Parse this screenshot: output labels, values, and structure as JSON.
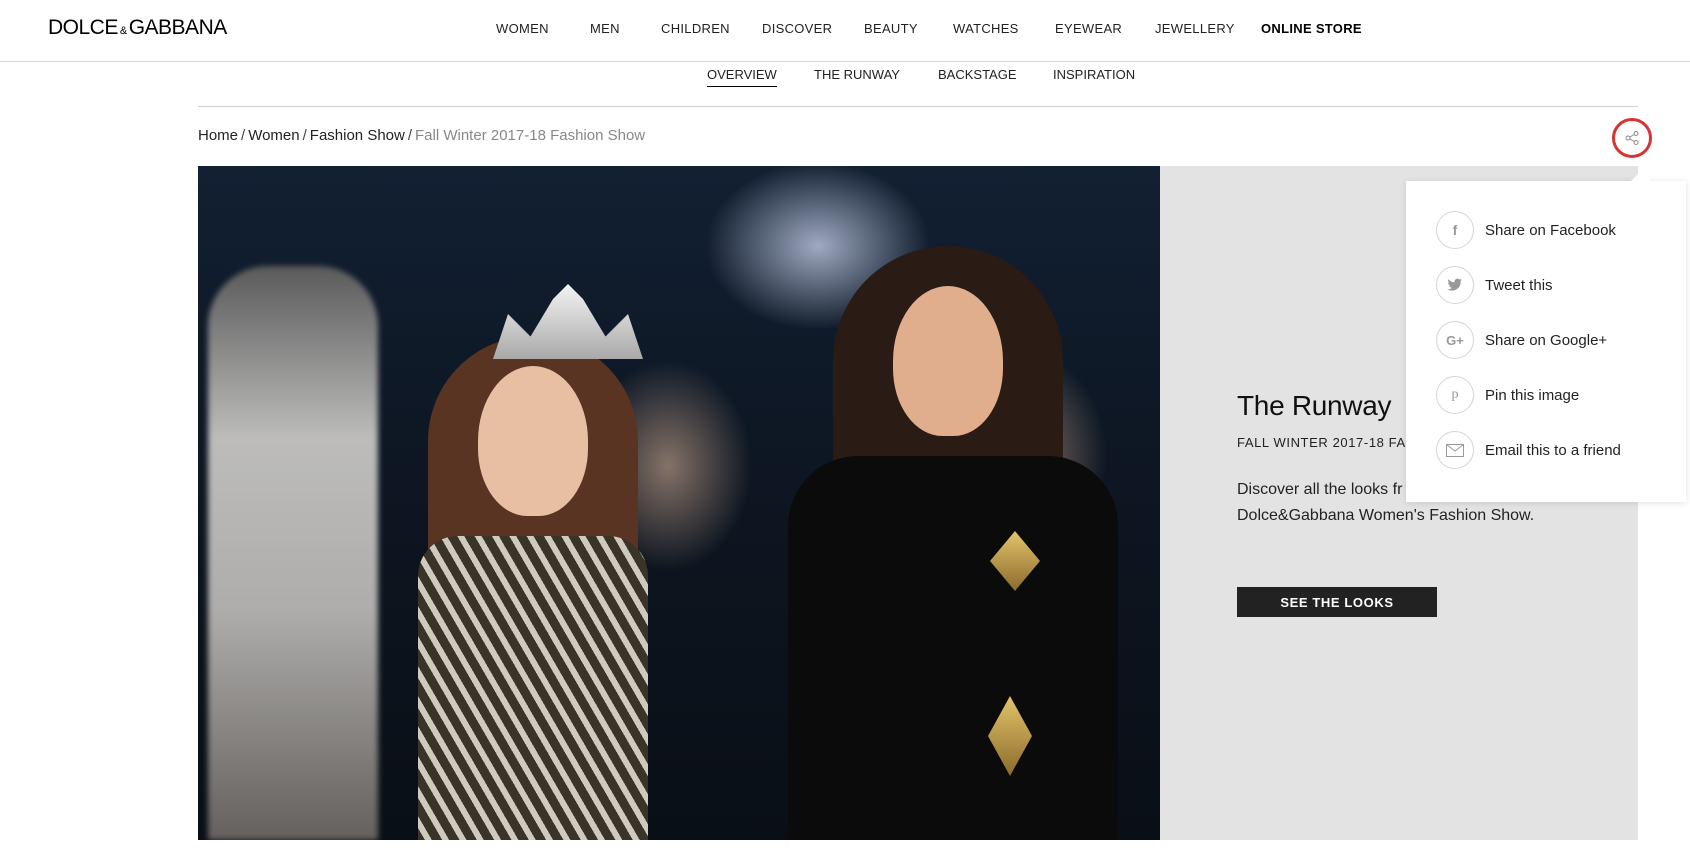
{
  "brand": {
    "logo_left": "DOLCE",
    "logo_amp": "&",
    "logo_right": "GABBANA"
  },
  "main_nav": {
    "women": "WOMEN",
    "men": "MEN",
    "children": "CHILDREN",
    "discover": "DISCOVER",
    "beauty": "BEAUTY",
    "watches": "WATCHES",
    "eyewear": "EYEWEAR",
    "jewellery": "JEWELLERY",
    "online_store": "ONLINE STORE"
  },
  "sub_nav": {
    "overview": "OVERVIEW",
    "the_runway": "THE RUNWAY",
    "backstage": "BACKSTAGE",
    "inspiration": "INSPIRATION",
    "active": "OVERVIEW"
  },
  "breadcrumb": {
    "home": "Home",
    "women": "Women",
    "fashion_show": "Fashion Show",
    "current": "Fall Winter 2017-18 Fashion Show",
    "separator": "/"
  },
  "hero": {
    "title": "The Runway",
    "subtitle": "FALL WINTER 2017-18 FAS",
    "description": "Discover all the looks fr the new Dolce&Gabbana Women's Fashion Show.",
    "cta": "SEE THE LOOKS"
  },
  "share": {
    "facebook": "Share on Facebook",
    "twitter": "Tweet this",
    "google": "Share on Google+",
    "pinterest": "Pin this image",
    "email": "Email this to a friend",
    "accent_color": "#d93232"
  }
}
